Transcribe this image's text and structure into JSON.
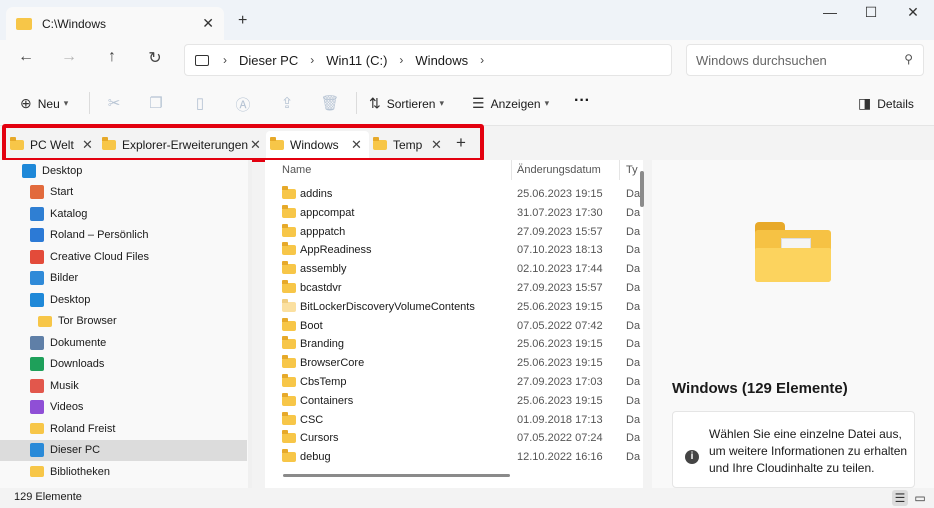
{
  "window": {
    "tab_title": "C:\\Windows",
    "new_tab_glyph": "+",
    "minimize_glyph": "—",
    "maximize_glyph": "☐",
    "close_glyph": "✕"
  },
  "address": {
    "crumbs": [
      "Dieser PC",
      "Win11 (C:)",
      "Windows"
    ],
    "search_placeholder": "Windows durchsuchen"
  },
  "commands": {
    "new_label": "Neu",
    "sort_label": "Sortieren",
    "view_label": "Anzeigen",
    "more_glyph": "···",
    "details_label": "Details"
  },
  "folder_tabs": [
    {
      "label": "PC Welt"
    },
    {
      "label": "Explorer-Erweiterungen"
    },
    {
      "label": "Windows"
    },
    {
      "label": "Temp"
    }
  ],
  "sidebar": {
    "items": [
      {
        "label": "Desktop",
        "icon": "desktop-icon"
      },
      {
        "label": "Start",
        "icon": "home-icon"
      },
      {
        "label": "Katalog",
        "icon": "gallery-icon"
      },
      {
        "label": "Roland – Persönlich",
        "icon": "onedrive-icon"
      },
      {
        "label": "Creative Cloud Files",
        "icon": "creative-cloud-icon"
      },
      {
        "label": "Bilder",
        "icon": "pictures-icon"
      },
      {
        "label": "Desktop",
        "icon": "desktop-icon"
      },
      {
        "label": "Tor Browser",
        "icon": "folder-icon"
      },
      {
        "label": "Dokumente",
        "icon": "documents-icon"
      },
      {
        "label": "Downloads",
        "icon": "downloads-icon"
      },
      {
        "label": "Musik",
        "icon": "music-icon"
      },
      {
        "label": "Videos",
        "icon": "videos-icon"
      },
      {
        "label": "Roland Freist",
        "icon": "folder-icon"
      },
      {
        "label": "Dieser PC",
        "icon": "pc-icon"
      },
      {
        "label": "Bibliotheken",
        "icon": "folder-icon"
      }
    ]
  },
  "filelist": {
    "columns": [
      "Name",
      "Änderungsdatum",
      "Ty"
    ],
    "rows": [
      {
        "name": "addins",
        "date": "25.06.2023 19:15",
        "type": "Da"
      },
      {
        "name": "appcompat",
        "date": "31.07.2023 17:30",
        "type": "Da"
      },
      {
        "name": "apppatch",
        "date": "27.09.2023 15:57",
        "type": "Da"
      },
      {
        "name": "AppReadiness",
        "date": "07.10.2023 18:13",
        "type": "Da"
      },
      {
        "name": "assembly",
        "date": "02.10.2023 17:44",
        "type": "Da"
      },
      {
        "name": "bcastdvr",
        "date": "27.09.2023 15:57",
        "type": "Da"
      },
      {
        "name": "BitLockerDiscoveryVolumeContents",
        "date": "25.06.2023 19:15",
        "type": "Da"
      },
      {
        "name": "Boot",
        "date": "07.05.2022 07:42",
        "type": "Da"
      },
      {
        "name": "Branding",
        "date": "25.06.2023 19:15",
        "type": "Da"
      },
      {
        "name": "BrowserCore",
        "date": "25.06.2023 19:15",
        "type": "Da"
      },
      {
        "name": "CbsTemp",
        "date": "27.09.2023 17:03",
        "type": "Da"
      },
      {
        "name": "Containers",
        "date": "25.06.2023 19:15",
        "type": "Da"
      },
      {
        "name": "CSC",
        "date": "01.09.2018 17:13",
        "type": "Da"
      },
      {
        "name": "Cursors",
        "date": "07.05.2022 07:24",
        "type": "Da"
      },
      {
        "name": "debug",
        "date": "12.10.2022 16:16",
        "type": "Da"
      }
    ]
  },
  "details": {
    "title": "Windows (129 Elemente)",
    "message": "Wählen Sie eine einzelne Datei aus, um weitere Informationen zu erhalten und Ihre Cloudinhalte zu teilen."
  },
  "status": {
    "count": "129 Elemente"
  }
}
